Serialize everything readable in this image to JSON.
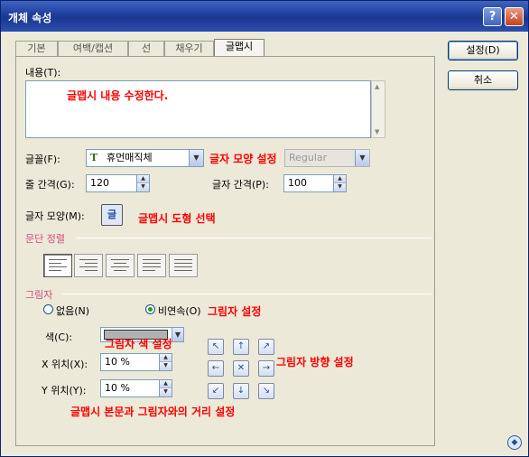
{
  "window": {
    "title": "개체 속성"
  },
  "titlebar": {
    "help": "?",
    "close": "✕"
  },
  "tabs": [
    "기본",
    "여백/캡션",
    "선",
    "채우기",
    "글맵시"
  ],
  "buttons": {
    "ok": "설정(D)",
    "cancel": "취소"
  },
  "content": {
    "label": "내용(T):",
    "value": ""
  },
  "font": {
    "label": "글꼴(F):",
    "value": "휴먼매직체",
    "style_value": "Regular"
  },
  "line_spacing": {
    "label": "줄 간격(G):",
    "value": "120"
  },
  "char_spacing": {
    "label": "글자 간격(P):",
    "value": "100"
  },
  "char_shape": {
    "label": "글자 모양(M):"
  },
  "paragraph": {
    "title": "문단 정렬"
  },
  "shadow": {
    "title": "그림자",
    "none_label": "없음(N)",
    "discontinuous_label": "비연속(O)",
    "color_label": "색(C):",
    "x_label": "X 위치(X):",
    "x_value": "10 %",
    "y_label": "Y 위치(Y):",
    "y_value": "10 %"
  },
  "annotations": {
    "content": "글맵시 내용 수정한다.",
    "font": "글자 모양 설정",
    "shape": "글맵시 도형 선택",
    "shadow": "그림자 설정",
    "shadow_color": "그림자 색 설정",
    "direction": "그림자 방향 설정",
    "distance": "글맵시 본문과 그림자와의 거리 설정"
  },
  "icons": {
    "font_type": "T",
    "shape": "글",
    "dir_nw": "↖",
    "dir_n": "↑",
    "dir_ne": "↗",
    "dir_w": "←",
    "dir_center": "✕",
    "dir_e": "→",
    "dir_sw": "↙",
    "dir_s": "↓",
    "dir_se": "↘",
    "corner": "◆"
  }
}
